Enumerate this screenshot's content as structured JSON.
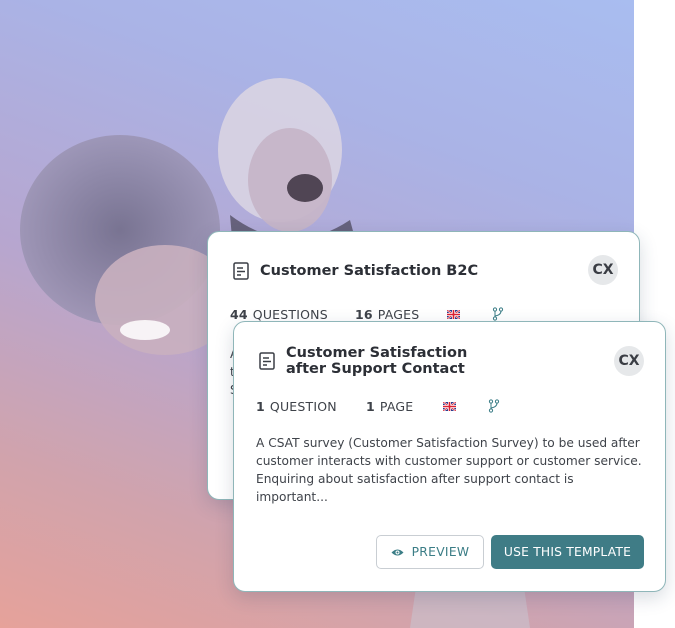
{
  "hero": {
    "image_desc_icon": "photo-two-women-laughing"
  },
  "back_card": {
    "icon": "document-icon",
    "title": "Customer Satisfaction B2C",
    "badge": "CX",
    "questions_count": "44",
    "questions_label": "QUESTIONS",
    "pages_count": "16",
    "pages_label": "PAGES",
    "flag_icon": "uk-flag-icon",
    "branch_icon": "branch-icon",
    "desc_fragment": [
      "A",
      "t",
      "S"
    ]
  },
  "front_card": {
    "icon": "document-icon",
    "title_line1": "Customer Satisfaction",
    "title_line2": "after Support Contact",
    "badge": "CX",
    "questions_count": "1",
    "questions_label": "QUESTION",
    "pages_count": "1",
    "pages_label": "PAGE",
    "flag_icon": "uk-flag-icon",
    "branch_icon": "branch-icon",
    "description_lines": [
      "A CSAT survey (Customer Satisfaction Survey) to be used after",
      "customer interacts with customer support or customer service.",
      "Enquiring about satisfaction after support contact is important..."
    ],
    "preview_label": "PREVIEW",
    "use_label": "USE THIS TEMPLATE"
  },
  "colors": {
    "accent": "#3f7c86",
    "card_border": "#8fb6b9"
  }
}
